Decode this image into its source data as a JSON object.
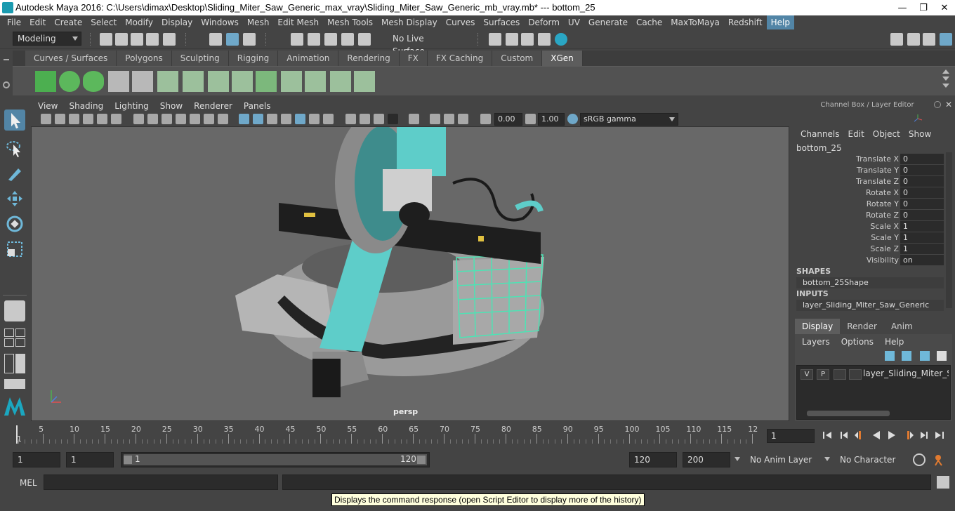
{
  "window": {
    "title": "Autodesk Maya 2016: C:\\Users\\dimax\\Desktop\\Sliding_Miter_Saw_Generic_max_vray\\Sliding_Miter_Saw_Generic_mb_vray.mb*   ---   bottom_25",
    "minimize": "—",
    "restore": "❐",
    "close": "✕"
  },
  "menu": [
    "File",
    "Edit",
    "Create",
    "Select",
    "Modify",
    "Display",
    "Windows",
    "Mesh",
    "Edit Mesh",
    "Mesh Tools",
    "Mesh Display",
    "Curves",
    "Surfaces",
    "Deform",
    "UV",
    "Generate",
    "Cache",
    "MaxToMaya",
    "Redshift",
    "Help"
  ],
  "menu_active": "Help",
  "statusline": {
    "mode": "Modeling",
    "live_surface": "No Live Surface"
  },
  "shelf_tabs": [
    "Curves / Surfaces",
    "Polygons",
    "Sculpting",
    "Rigging",
    "Animation",
    "Rendering",
    "FX",
    "FX Caching",
    "Custom",
    "XGen"
  ],
  "shelf_active": "XGen",
  "viewport": {
    "menu": [
      "View",
      "Shading",
      "Lighting",
      "Show",
      "Renderer",
      "Panels"
    ],
    "exposure": "0.00",
    "gamma": "1.00",
    "colorspace": "sRGB gamma",
    "camera": "persp"
  },
  "channel_box": {
    "title": "Channel Box / Layer Editor",
    "menu": [
      "Channels",
      "Edit",
      "Object",
      "Show"
    ],
    "object": "bottom_25",
    "attributes": [
      {
        "label": "Translate X",
        "value": "0"
      },
      {
        "label": "Translate Y",
        "value": "0"
      },
      {
        "label": "Translate Z",
        "value": "0"
      },
      {
        "label": "Rotate X",
        "value": "0"
      },
      {
        "label": "Rotate Y",
        "value": "0"
      },
      {
        "label": "Rotate Z",
        "value": "0"
      },
      {
        "label": "Scale X",
        "value": "1"
      },
      {
        "label": "Scale Y",
        "value": "1"
      },
      {
        "label": "Scale Z",
        "value": "1"
      },
      {
        "label": "Visibility",
        "value": "on"
      }
    ],
    "shapes_header": "SHAPES",
    "shape": "bottom_25Shape",
    "inputs_header": "INPUTS",
    "input": "layer_Sliding_Miter_Saw_Generic"
  },
  "layer_editor": {
    "tabs": [
      "Display",
      "Render",
      "Anim"
    ],
    "active_tab": "Display",
    "menu": [
      "Layers",
      "Options",
      "Help"
    ],
    "layer": {
      "v": "V",
      "p": "P",
      "name": "layer_Sliding_Miter_Saw_Generic"
    }
  },
  "timeline": {
    "labels": [
      "5",
      "10",
      "15",
      "20",
      "25",
      "30",
      "35",
      "40",
      "45",
      "50",
      "55",
      "60",
      "65",
      "70",
      "75",
      "80",
      "85",
      "90",
      "95",
      "100",
      "105",
      "110",
      "115",
      "12"
    ],
    "start_marker": "1",
    "current_frame": "1"
  },
  "range": {
    "start": "1",
    "playback_start": "1",
    "slider_start": "1",
    "slider_end": "120",
    "playback_end": "120",
    "end": "200",
    "anim_layer": "No Anim Layer",
    "character_set": "No Character Set"
  },
  "cmd": {
    "lang": "MEL",
    "tooltip": "Displays the command response (open Script Editor to display more of the history)"
  }
}
